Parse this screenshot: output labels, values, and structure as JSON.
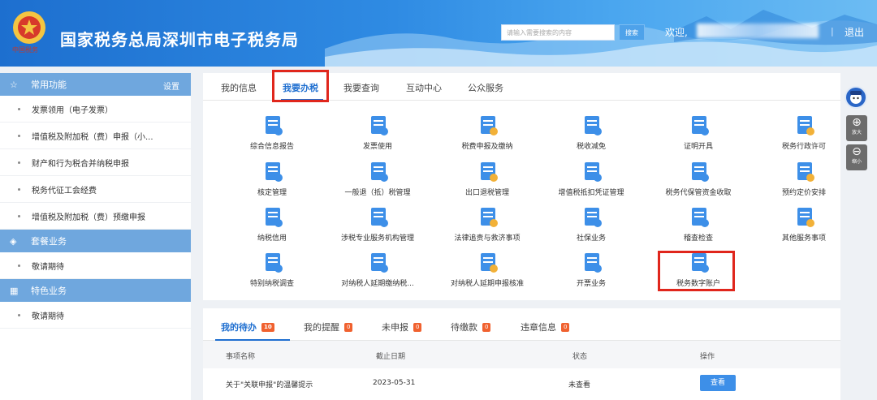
{
  "header": {
    "title": "国家税务总局深圳市电子税务局",
    "logo_text": "中国税务",
    "search_placeholder": "请输入需要搜索的内容",
    "search_button": "搜索",
    "welcome": "欢迎,",
    "separator": "|",
    "logout": "退出"
  },
  "sidebar": {
    "sections": [
      {
        "title": "常用功能",
        "icon": "star-icon",
        "settings": "设置",
        "items": [
          "发票领用（电子发票）",
          "增值税及附加税（费）申报（小...",
          "财产和行为税合并纳税申报",
          "税务代征工会经费",
          "增值税及附加税（费）预缴申报"
        ]
      },
      {
        "title": "套餐业务",
        "icon": "cube-icon",
        "items": [
          "敬请期待"
        ]
      },
      {
        "title": "特色业务",
        "icon": "grid-icon",
        "items": [
          "敬请期待"
        ]
      }
    ]
  },
  "main": {
    "tabs": [
      "我的信息",
      "我要办税",
      "我要查询",
      "互动中心",
      "公众服务"
    ],
    "active_tab": "我要办税",
    "tiles": [
      "综合信息报告",
      "发票使用",
      "税费申报及缴纳",
      "税收减免",
      "证明开具",
      "税务行政许可",
      "核定管理",
      "一般退（抵）税管理",
      "出口退税管理",
      "增值税抵扣凭证管理",
      "税务代保管资金收取",
      "预约定价安排",
      "纳税信用",
      "涉税专业服务机构管理",
      "法律追责与救济事项",
      "社保业务",
      "稽查检查",
      "其他服务事项",
      "特别纳税调查",
      "对纳税人延期缴纳税...",
      "对纳税人延期申报核准",
      "开票业务",
      "税务数字账户"
    ],
    "highlighted_tile": "税务数字账户"
  },
  "float_tools": {
    "zoom_in": "放大",
    "zoom_out": "缩小"
  },
  "todo": {
    "tabs": [
      {
        "label": "我的待办",
        "count": "10"
      },
      {
        "label": "我的提醒",
        "count": "0"
      },
      {
        "label": "未申报",
        "count": "0"
      },
      {
        "label": "待缴款",
        "count": "0"
      },
      {
        "label": "违章信息",
        "count": "0"
      }
    ],
    "columns": [
      "事项名称",
      "截止日期",
      "状态",
      "操作"
    ],
    "rows": [
      {
        "name": "关于\"关联申报\"的温馨提示",
        "deadline": "2023-05-31",
        "status": "未查看",
        "action": "查看"
      }
    ]
  },
  "colors": {
    "brand_blue": "#1f6fd0",
    "highlight_red": "#e0261c",
    "sidebar_head": "#6fa7de",
    "badge": "#f0612f"
  }
}
